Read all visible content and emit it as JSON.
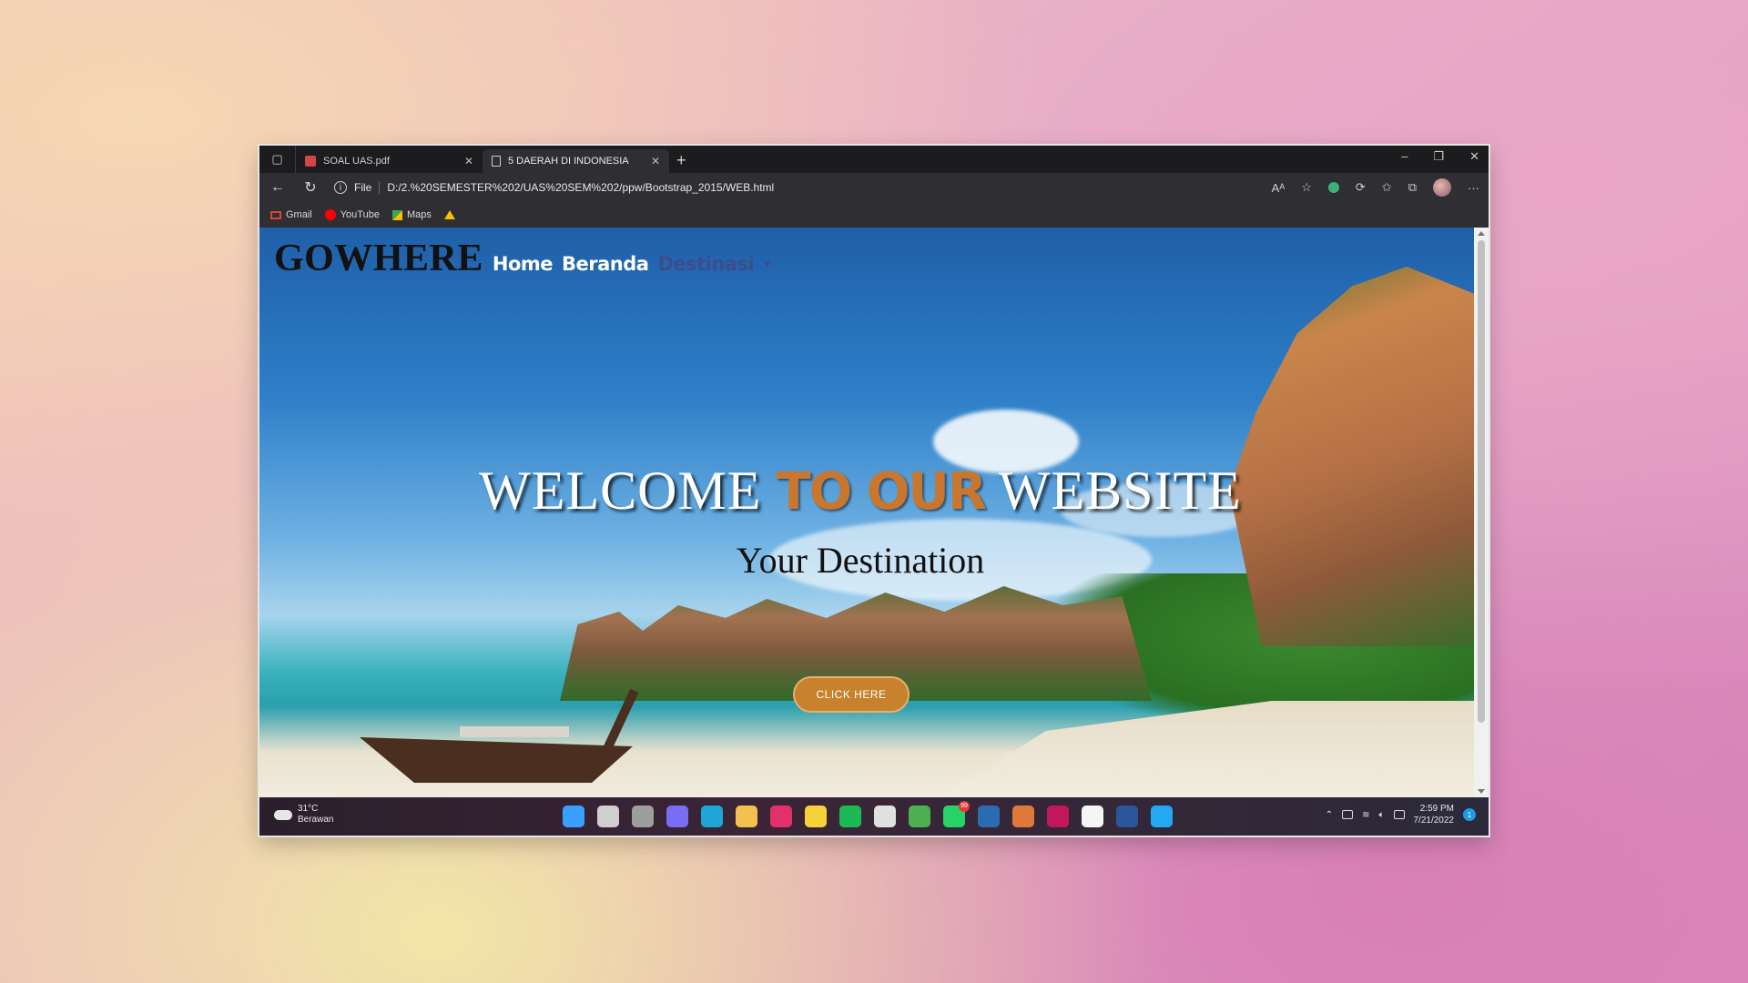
{
  "browser": {
    "tabs": [
      {
        "title": "SOAL UAS.pdf",
        "icon": "pdf-icon"
      },
      {
        "title": "5 DAERAH DI INDONESIA",
        "icon": "document-icon",
        "active": true
      }
    ],
    "new_tab_symbol": "+",
    "address": {
      "scheme_label": "File",
      "url": "D:/2.%20SEMESTER%202/UAS%20SEM%202/ppw/Bootstrap_2015/WEB.html"
    },
    "bookmarks": [
      {
        "label": "Gmail",
        "icon": "gmail-icon"
      },
      {
        "label": "YouTube",
        "icon": "youtube-icon"
      },
      {
        "label": "Maps",
        "icon": "maps-icon"
      },
      {
        "label": "",
        "icon": "drive-icon"
      }
    ]
  },
  "site": {
    "brand": "GOWHERE",
    "nav": [
      {
        "label": "Home"
      },
      {
        "label": "Beranda"
      },
      {
        "label": "Destinasi",
        "dropdown": true
      }
    ],
    "hero": {
      "title_part1": "WELCOME ",
      "title_accent": "TO OUR",
      "title_part2": " WEBSITE",
      "subtitle": "Your Destination",
      "cta": "CLICK HERE"
    },
    "colors": {
      "accent": "#c8822e",
      "nav_dropdown": "#3d4c8a"
    }
  },
  "taskbar": {
    "weather": {
      "temp": "31°C",
      "condition": "Berawan"
    },
    "apps": [
      {
        "icon": "windows-start-icon",
        "color": "#3aa0ff"
      },
      {
        "icon": "search-icon",
        "color": "#cfcfcf"
      },
      {
        "icon": "task-view-icon",
        "color": "#9e9e9e"
      },
      {
        "icon": "teams-chat-icon",
        "color": "#7b6cf6"
      },
      {
        "icon": "edge-icon",
        "color": "#1fa6d6"
      },
      {
        "icon": "file-explorer-icon",
        "color": "#f2c14e"
      },
      {
        "icon": "instagram-icon",
        "color": "#e1306c"
      },
      {
        "icon": "kakao-icon",
        "color": "#f7d13a"
      },
      {
        "icon": "spotify-icon",
        "color": "#1db954"
      },
      {
        "icon": "store-icon",
        "color": "#e0e0e0"
      },
      {
        "icon": "chrome-icon",
        "color": "#4caf50",
        "badge": ""
      },
      {
        "icon": "whatsapp-icon",
        "color": "#25d366",
        "badge": "99"
      },
      {
        "icon": "netbeans-icon",
        "color": "#2b6cb0"
      },
      {
        "icon": "app-circle-icon",
        "color": "#e07a3a"
      },
      {
        "icon": "intellij-icon",
        "color": "#c2185b"
      },
      {
        "icon": "notepad-icon",
        "color": "#f5f5f5"
      },
      {
        "icon": "word-icon",
        "color": "#2b579a"
      },
      {
        "icon": "vscode-icon",
        "color": "#23a9f2"
      }
    ],
    "time": "2:59 PM",
    "date": "7/21/2022",
    "notifications": "1"
  }
}
